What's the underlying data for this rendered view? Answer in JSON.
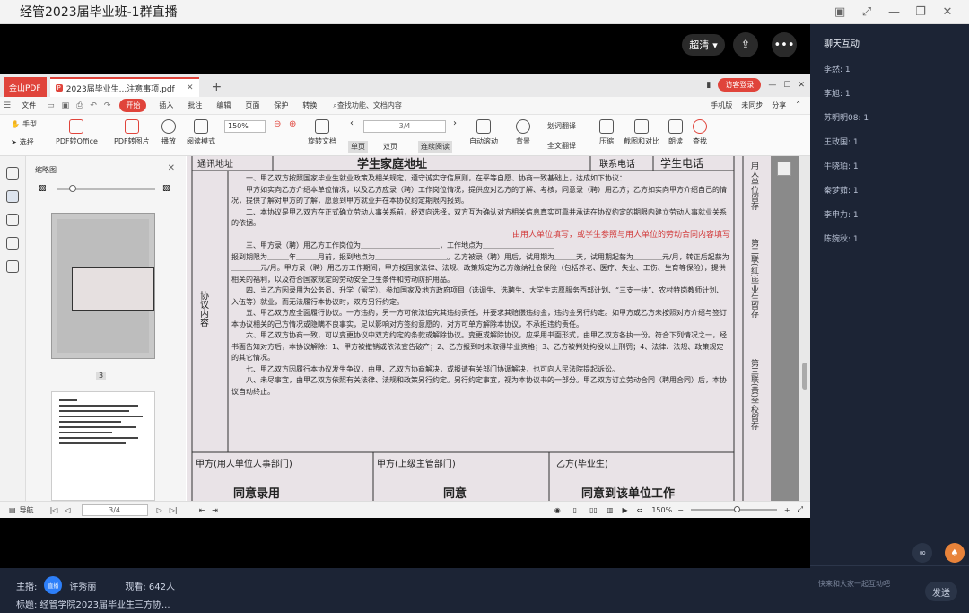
{
  "window": {
    "title": "经管2023届毕业班-1群直播"
  },
  "video": {
    "quality_label": "超清"
  },
  "pdf": {
    "brand_tab": "金山PDF",
    "doc_tab": "2023届毕业生...注意事项.pdf",
    "login_label": "访客登录",
    "menu": [
      "文件",
      "开始",
      "插入",
      "批注",
      "编辑",
      "页面",
      "保护",
      "转换"
    ],
    "search_label": "查找功能、文档内容",
    "menu_right": [
      "手机版",
      "未同步",
      "分享"
    ],
    "ribbon": {
      "hand": "手型",
      "select": "选择",
      "pdf_to_office": "PDF转Office",
      "pdf_to_image": "PDF转图片",
      "play": "播放",
      "read_mode": "阅读模式",
      "zoom": "150%",
      "rotate": "旋转文档",
      "page": "3/4",
      "single": "单页",
      "double": "双页",
      "continuous": "连续阅读",
      "auto_scroll": "自动滚动",
      "background": "背景",
      "word_translate": "划词翻译",
      "full_translate": "全文翻译",
      "compress": "压缩",
      "screenshot_compare": "截图和对比",
      "read_aloud": "朗读",
      "find": "查找"
    },
    "thumbnails": {
      "title": "缩略图",
      "page_label": "3"
    },
    "status": {
      "nav": "导航",
      "page": "3/4",
      "zoom": "150%"
    },
    "document": {
      "row1": [
        "通讯地址",
        "学生家庭地址",
        "联系电话",
        "学生电话"
      ],
      "side_label": "协议内容",
      "right_labels": [
        "用人单位留存",
        "第二联(红)毕业生留存",
        "第三联(黄)学校留存"
      ],
      "paragraphs": [
        "一、甲乙双方按照国家毕业生就业政策及相关规定，遵守诚实守信原则，在平等自愿、协商一致基础上，达成如下协议：",
        "甲方如实向乙方介绍本单位情况，以及乙方应录（聘）工作岗位情况，提供应对乙方的了解、考核，同意录（聘）用乙方；乙方如实向甲方介绍自己的情况，提供了解对甲方的了解，愿意到甲方就业并在本协议约定期限内报到。",
        "二、本协议是甲乙双方在正式确立劳动人事关系前，经双向选择，双方互为确认对方相关信息真实可靠并承诺在协议约定的期限内建立劳动人事就业关系的依据。",
        "三、甲方录（聘）用乙方工作岗位为＿＿＿＿＿＿＿＿＿＿＿，工作地点为＿＿＿＿＿＿＿＿＿＿",
        "报到期限为＿＿＿年＿＿＿月前，报到地点为＿＿＿＿＿＿＿＿＿＿。乙方被录（聘）用后，试用期为＿＿＿天，试用期起薪为＿＿＿＿元/月，转正后起薪为＿＿＿＿元/月。甲方录（聘）用乙方工作期间，甲方按国家法律、法规、政策规定为乙方缴纳社会保险（包括养老、医疗、失业、工伤、生育等保险），提供相关的福利，以及符合国家规定的劳动安全卫生条件和劳动防护用品。",
        "四、当乙方因录用为公务员、升学（留学）、参加国家及地方政府项目（选调生、选聘生、大学生志愿服务西部计划、“三支一扶”、农村特岗教师计划、入伍等）就业，而无法履行本协议时，双方另行约定。",
        "五、甲乙双方应全面履行协议。一方违约，另一方可依法追究其违约责任，并要求其赔偿违约金，违约金另行约定。如甲方或乙方未按照对方介绍与签订本协议相关的己方情况或隐瞒不良事实，足以影响对方签约意愿的，对方可单方解除本协议，不承担违约责任。",
        "六、甲乙双方协商一致，可以变更协议中双方约定的条款或解除协议。变更或解除协议，应采用书面形式，由甲乙双方各执一份。符合下列情况之一，经书面告知对方后，本协议解除：1、甲方被撤销或依法宣告破产；2、乙方报到时未取得毕业资格；3、乙方被判处拘役以上刑罚；4、法律、法规、政策规定的其它情况。",
        "七、甲乙双方因履行本协议发生争议，由甲、乙双方协商解决，或报请有关部门协调解决，也可向人民法院提起诉讼。",
        "八、未尽事宜，由甲乙双方依照有关法律、法规和政策另行约定。另行约定事宜，视为本协议书的一部分。甲乙双方订立劳动合同（聘用合同）后，本协议自动终止。"
      ],
      "annotation": "由用人单位填写，或学生参照与用人单位的劳动合同内容填写",
      "sig_row": [
        "甲方(用人单位人事部门)",
        "甲方(上级主管部门)",
        "乙方(毕业生)"
      ],
      "sig_row2": [
        "同意录用",
        "同意",
        "同意到该单位工作"
      ]
    }
  },
  "info": {
    "host_label": "主播:",
    "host_avatar": "直播",
    "host_name": "许秀丽",
    "viewers": "观看: 642人",
    "topic": "标题: 经管学院2023届毕业生三方协..."
  },
  "chat": {
    "title": "聊天互动",
    "messages": [
      "李然: 1",
      "李旭: 1",
      "苏明明08: 1",
      "王政国: 1",
      "牛晓珀: 1",
      "秦梦茹: 1",
      "李申力: 1",
      "陈婉秋: 1"
    ],
    "input_placeholder": "快来和大家一起互动吧",
    "send_label": "发送"
  }
}
